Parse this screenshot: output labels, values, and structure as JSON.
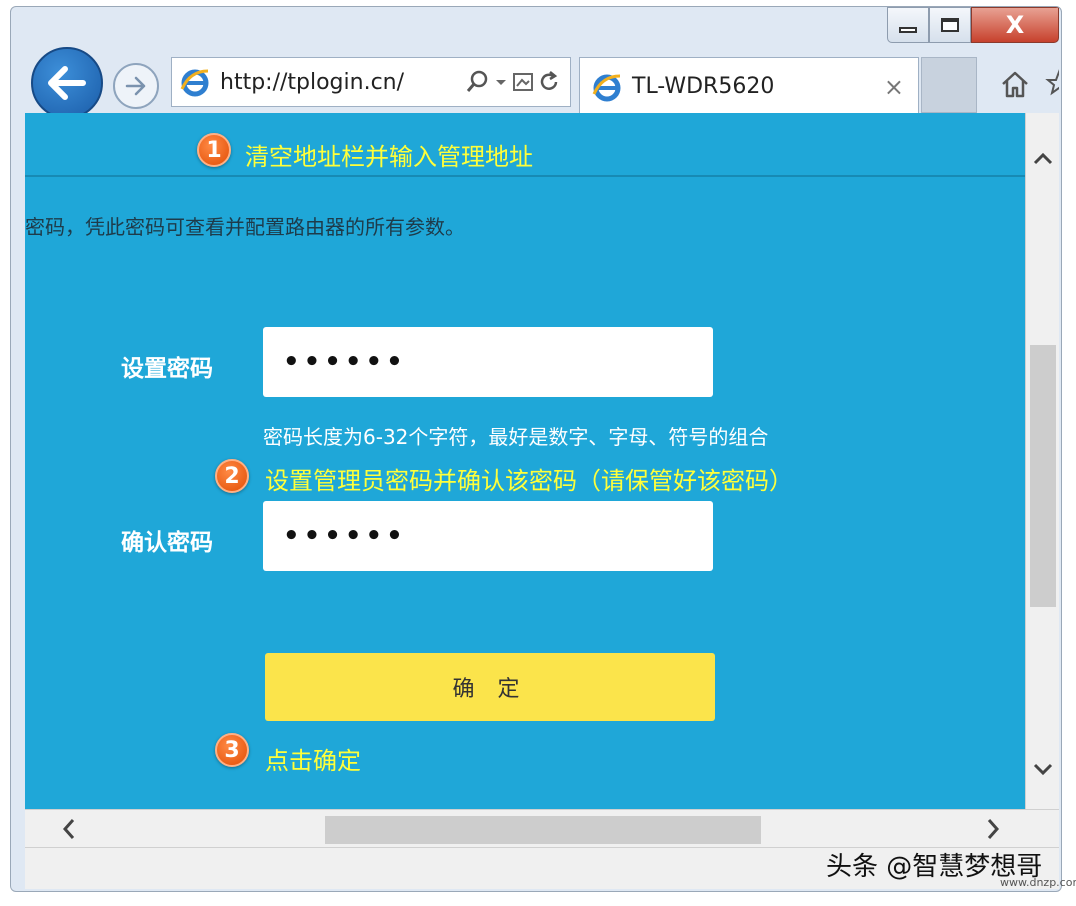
{
  "browser": {
    "address_url": "http://tplogin.cn/",
    "tab_title": "TL-WDR5620",
    "tab_close": "×",
    "close_glyph": "X"
  },
  "page": {
    "annotation_1": {
      "number": "1",
      "text": "清空地址栏并输入管理地址"
    },
    "intro_text": "密码，凭此密码可查看并配置路由器的所有参数。",
    "set_password_label": "设置密码",
    "set_password_value": "••••••",
    "password_hint": "密码长度为6-32个字符，最好是数字、字母、符号的组合",
    "annotation_2": {
      "number": "2",
      "text": "设置管理员密码并确认该密码（请保管好该密码）"
    },
    "confirm_password_label": "确认密码",
    "confirm_password_value": "••••••",
    "confirm_button": "确 定",
    "annotation_3": {
      "number": "3",
      "text": "点击确定"
    }
  },
  "watermark": {
    "text": "头条 @智慧梦想哥",
    "small": "www.dnzp.com"
  },
  "colors": {
    "page_bg": "#1fa7d8",
    "annotation": "#ffff3a",
    "badge": "#e85a10",
    "button": "#fbe44b"
  }
}
